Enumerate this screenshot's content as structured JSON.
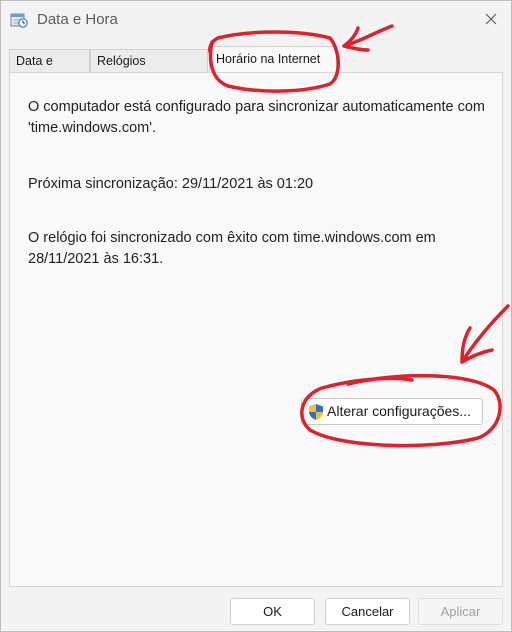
{
  "window": {
    "title": "Data e Hora",
    "icon": "calendar-clock-icon"
  },
  "tabs": [
    {
      "label": "Data e Hora",
      "active": false
    },
    {
      "label": "Relógios Adicionais",
      "active": false
    },
    {
      "label": "Horário na Internet",
      "active": true
    }
  ],
  "internet_time": {
    "sync_info": "O computador está configurado para sincronizar automaticamente com 'time.windows.com'.",
    "next_sync": "Próxima sincronização: 29/11/2021 às 01:20",
    "last_sync": "O relógio foi sincronizado com êxito com time.windows.com em 28/11/2021 às 16:31.",
    "change_settings_label": "Alterar configurações...",
    "change_settings_icon": "uac-shield-icon"
  },
  "footer": {
    "ok_label": "OK",
    "cancel_label": "Cancelar",
    "apply_label": "Aplicar"
  },
  "colors": {
    "annotation_red": "#e0202a"
  }
}
